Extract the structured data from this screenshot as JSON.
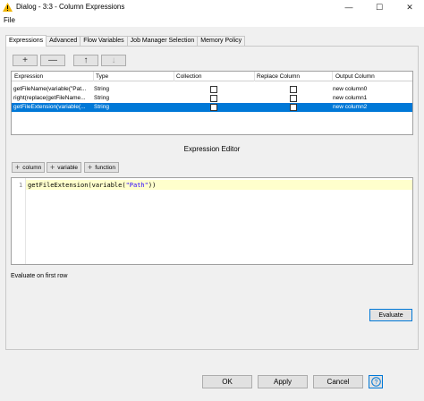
{
  "window": {
    "title": "Dialog - 3:3 - Column Expressions",
    "minimize": "—",
    "maximize": "☐",
    "close": "✕"
  },
  "menu": {
    "file": "File"
  },
  "tabs": [
    {
      "label": "Expressions",
      "active": true
    },
    {
      "label": "Advanced",
      "active": false
    },
    {
      "label": "Flow Variables",
      "active": false
    },
    {
      "label": "Job Manager Selection",
      "active": false
    },
    {
      "label": "Memory Policy",
      "active": false
    }
  ],
  "toolbar": {
    "add": "+",
    "remove": "—",
    "up": "↑",
    "down": "↓"
  },
  "table": {
    "headers": {
      "expression": "Expression",
      "type": "Type",
      "collection": "Collection",
      "replace": "Replace Column",
      "output": "Output Column"
    },
    "rows": [
      {
        "expression": "getFileName(variable(\"Pat...",
        "type": "String",
        "output": "new column0",
        "selected": false
      },
      {
        "expression": "right(replace(getFileName...",
        "type": "String",
        "output": "new column1",
        "selected": false
      },
      {
        "expression": "getFileExtension(variable(...",
        "type": "String",
        "output": "new column2",
        "selected": true
      }
    ]
  },
  "editor": {
    "title": "Expression Editor",
    "buttons": {
      "column": "column",
      "variable": "variable",
      "function": "function"
    },
    "line_number": "1",
    "code_prefix": "getFileExtension(variable(",
    "code_string": "\"Path\"",
    "code_suffix": "))"
  },
  "evaluate": {
    "label": "Evaluate on first row",
    "button": "Evaluate"
  },
  "dialog_buttons": {
    "ok": "OK",
    "apply": "Apply",
    "cancel": "Cancel"
  },
  "colors": {
    "selection": "#0078d7",
    "highlight_line": "#ffffcc",
    "string": "#2a00ff",
    "warning": "#f0b400"
  }
}
